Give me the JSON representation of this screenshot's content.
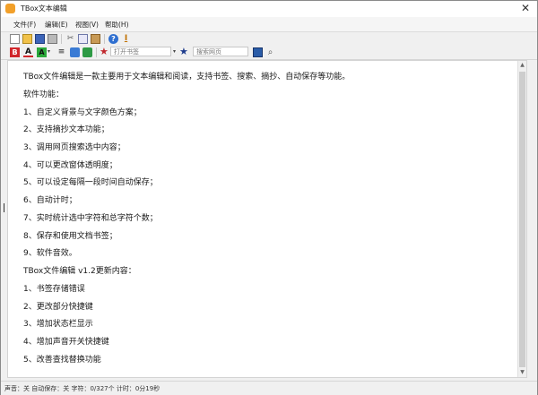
{
  "window": {
    "title": "TBox文本编辑",
    "close_glyph": "✕"
  },
  "menu": {
    "file": "文件(F)",
    "edit": "编辑(E)",
    "view": "视图(V)",
    "help": "帮助(H)"
  },
  "toolbar": {
    "new_icon": "new-file-icon",
    "open_icon": "open-folder-icon",
    "save_icon": "save-icon",
    "print_icon": "print-icon",
    "cut_icon": "cut-icon",
    "copy_icon": "copy-icon",
    "paste_icon": "paste-icon",
    "help_icon": "help-icon",
    "font_icon": "font-icon",
    "bold_label": "B",
    "font_color_label": "A",
    "highlight_label": "A",
    "open_bookmark_placeholder": "打开书签",
    "search_web_placeholder": "搜索网页",
    "colors": {
      "bold_bg": "#d0262b",
      "highlight_bg": "#2aa83a",
      "bookmark_star": "#c0272d",
      "search_star": "#1c3a8c"
    }
  },
  "editor": {
    "lines": [
      "TBox文件编辑是一款主要用于文本编辑和阅读，支持书签、搜索、摘抄、自动保存等功能。",
      "软件功能：",
      "1、自定义背景与文字颜色方案；",
      "2、支持摘抄文本功能；",
      "3、调用网页搜索选中内容；",
      "4、可以更改窗体透明度；",
      "5、可以设定每隔一段时间自动保存；",
      "6、自动计时；",
      "7、实时统计选中字符和总字符个数；",
      "8、保存和使用文档书签；",
      "9、软件音效。",
      "TBox文件编辑 v1.2更新内容：",
      "1、书签存储错误",
      "2、更改部分快捷键",
      "3、增加状态栏显示",
      "4、增加声音开关快捷键",
      "5、改善查找替换功能"
    ]
  },
  "status": {
    "text": "声音：关  自动保存：关  字符：0/327个  计时：0分19秒"
  }
}
